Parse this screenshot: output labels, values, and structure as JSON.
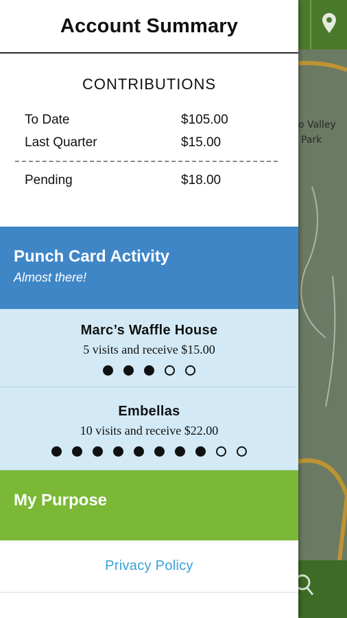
{
  "header": {
    "title": "Account Summary"
  },
  "contributions": {
    "heading": "CONTRIBUTIONS",
    "rows": [
      {
        "label": "To Date",
        "value": "$105.00"
      },
      {
        "label": "Last Quarter",
        "value": "$15.00"
      }
    ],
    "pending": {
      "label": "Pending",
      "value": "$18.00"
    }
  },
  "punch": {
    "title": "Punch Card Activity",
    "subtitle": "Almost there!",
    "cards": [
      {
        "name": "Marc’s Waffle House",
        "desc": "5 visits and receive $15.00",
        "completed": 3,
        "total": 5
      },
      {
        "name": "Embellas",
        "desc": "10 visits and receive $22.00",
        "completed": 8,
        "total": 10
      }
    ]
  },
  "purpose": {
    "label": "My Purpose"
  },
  "privacy": {
    "label": "Privacy Policy"
  },
  "map": {
    "labels": [
      "o Valley",
      "Park"
    ],
    "colors": {
      "topbar": "#4b7a2c",
      "bottombar": "#3e6b25"
    }
  },
  "colors": {
    "punch_header": "#3f86c7",
    "card_bg": "#d3eaf6",
    "purpose": "#7ab835",
    "link": "#3aa0d8"
  }
}
